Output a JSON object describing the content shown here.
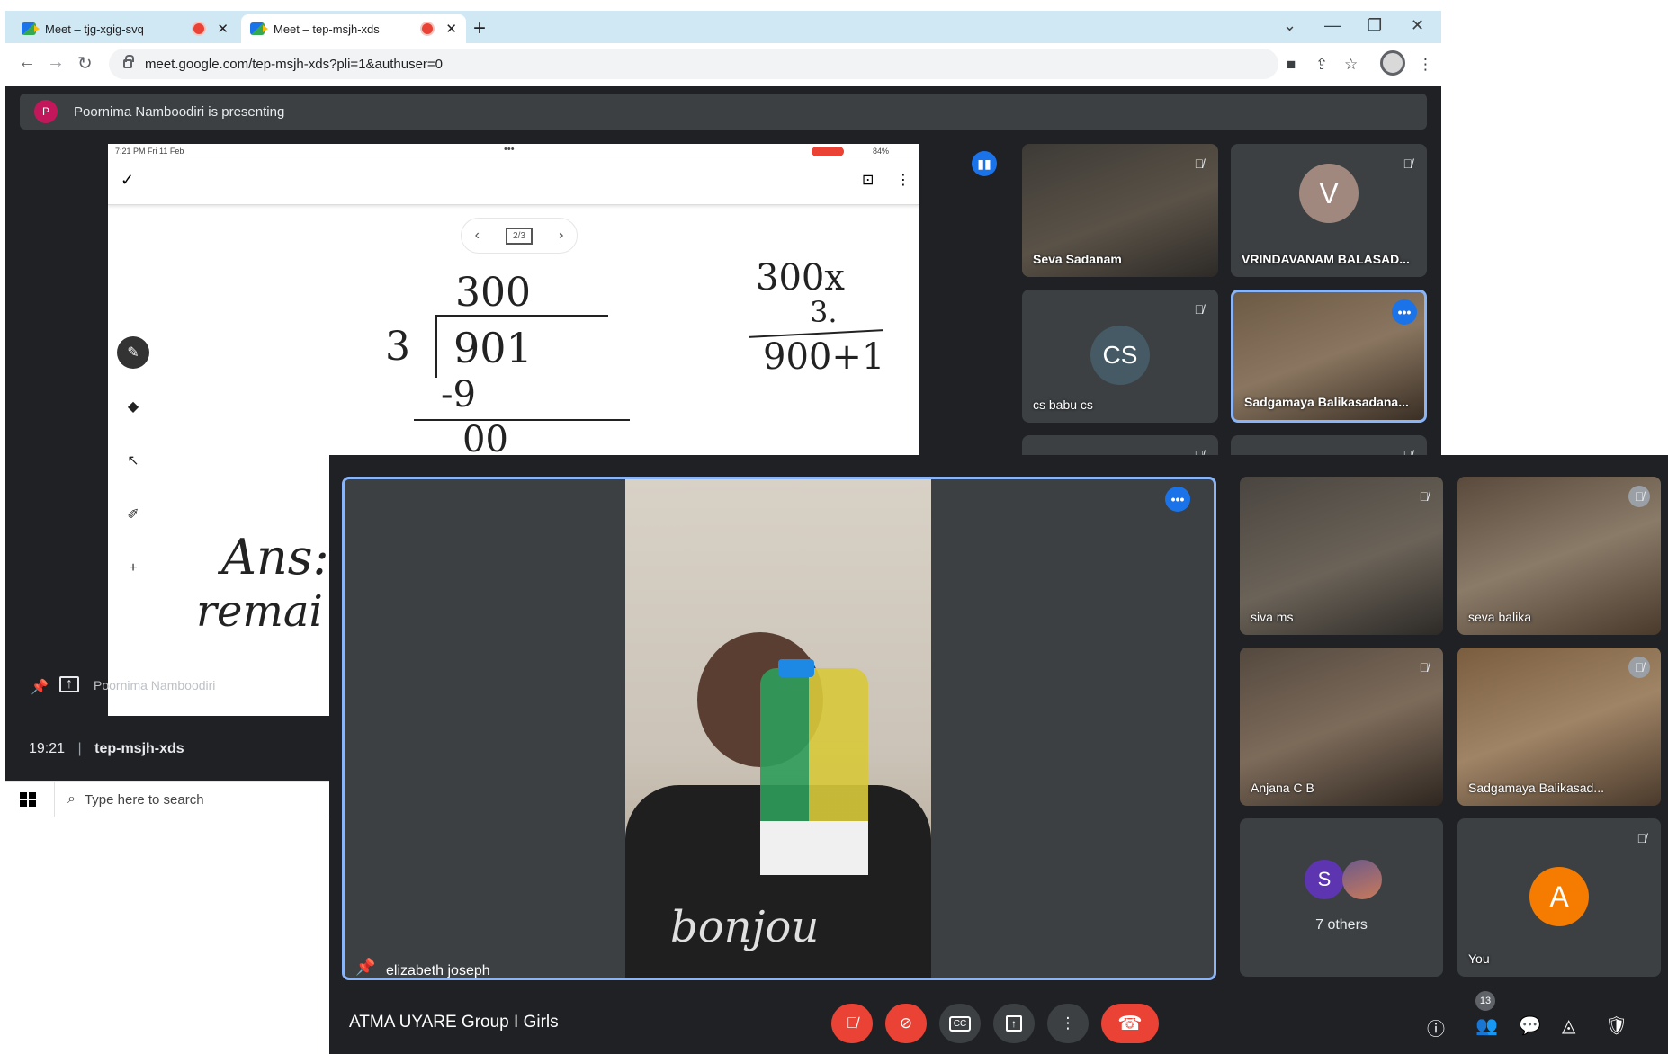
{
  "browser": {
    "tabs": [
      {
        "title": "Meet – tjg-xgig-svq",
        "recording": true
      },
      {
        "title": "Meet – tep-msjh-xds",
        "recording": true
      }
    ],
    "url": "meet.google.com/tep-msjh-xds?pli=1&authuser=0"
  },
  "presentation": {
    "banner": "Poornima Namboodiri is presenting",
    "avatar_letter": "P",
    "presenter_label": "Poornima Namboodiri",
    "ipad_time": "7:21 PM  Fri 11 Feb",
    "ipad_battery": "84%",
    "page_indicator": "2/3",
    "handwriting": {
      "quotient": "300",
      "divisor": "3",
      "dividend": "901",
      "subtract": "-9",
      "remainder_row": "00",
      "multiply_top": "300x",
      "multiply_by": "3.",
      "product": "900+1",
      "ans": "Ans:",
      "remain": "remai"
    }
  },
  "meeting_back": {
    "clock": "19:21",
    "code": "tep-msjh-xds",
    "tiles": [
      {
        "name": "Seva Sadanam",
        "muted": true
      },
      {
        "name": "VRINDAVANAM BALASAD...",
        "initial": "V",
        "muted": true
      },
      {
        "name": "cs babu cs",
        "initial": "CS",
        "muted": true
      },
      {
        "name": "Sadgamaya Balikasadana...",
        "muted": false
      }
    ]
  },
  "taskbar": {
    "search_placeholder": "Type here to search"
  },
  "meeting_front": {
    "title": "ATMA UYARE Group I Girls",
    "main_speaker": "elizabeth joseph",
    "shirt_text": "bonjou",
    "participants_count": "13",
    "tiles": [
      {
        "name": "siva ms",
        "muted": true
      },
      {
        "name": "seva balika",
        "muted": true
      },
      {
        "name": "Anjana C B",
        "muted": true
      },
      {
        "name": "Sadgamaya Balikasad...",
        "muted": true
      },
      {
        "name": "7 others",
        "initial": "S"
      },
      {
        "name": "You",
        "initial": "A",
        "muted": true
      }
    ]
  },
  "colors": {
    "meet_bg": "#202124",
    "tile_bg": "#3c4043",
    "end_call_red": "#ea4335",
    "accent_blue": "#1a73e8",
    "active_border": "#8ab4f8"
  }
}
